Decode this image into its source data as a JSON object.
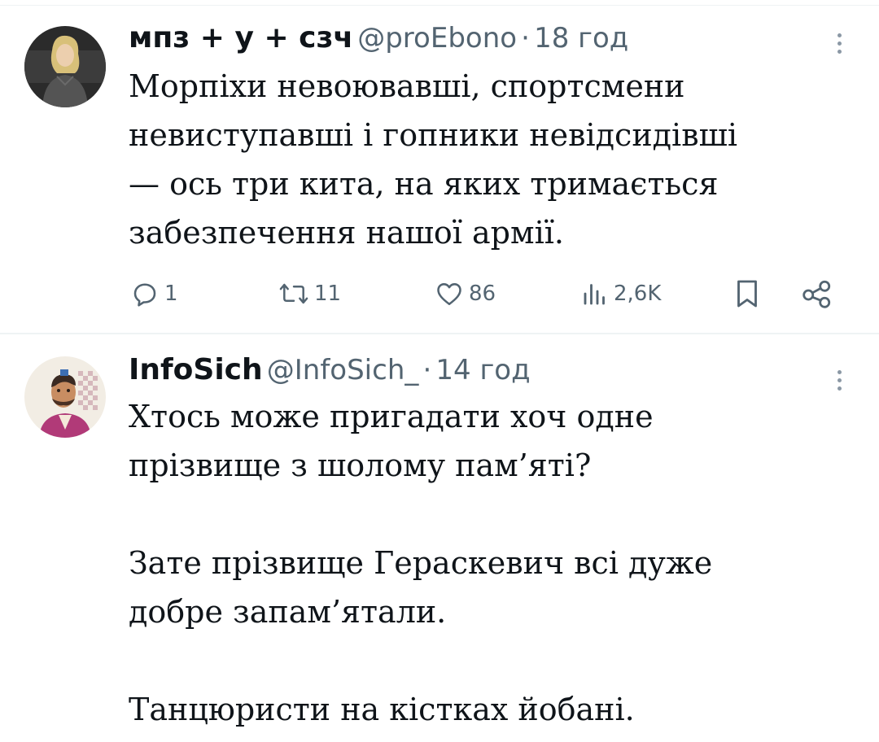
{
  "tweets": [
    {
      "display_name": "мпз + у + сзч",
      "handle": "@proEbono",
      "separator": "·",
      "time": "18 год",
      "text": "Морпіхи невоювавші, спортсмени\nневиступавші і гопники невідсидівші\n— ось три кита, на яких тримається\nзабезпечення нашої армії.",
      "actions": {
        "replies": "1",
        "retweets": "11",
        "likes": "86",
        "views": "2,6K"
      }
    },
    {
      "display_name": "InfoSich",
      "handle": "@InfoSich_",
      "separator": "·",
      "time": "14 год",
      "text": "Хтось може пригадати хоч одне\nпрізвище з шолому пам’яті?\n\nЗате прізвище Гераскевич всі дуже\nдобре запам’ятали.\n\nТанцюристи на кістках йобані."
    }
  ],
  "icons": {
    "reply": "reply-icon",
    "retweet": "retweet-icon",
    "like": "heart-icon",
    "views": "views-icon",
    "bookmark": "bookmark-icon",
    "share": "share-icon",
    "more": "more-vertical-icon"
  },
  "colors": {
    "text": "#0f1419",
    "secondary": "#536471",
    "divider": "#eff3f4"
  }
}
